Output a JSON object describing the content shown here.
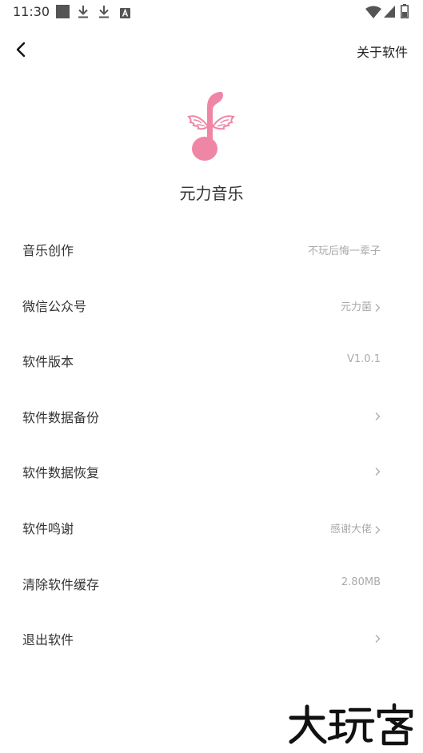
{
  "status_bar": {
    "time": "11:30",
    "icons": [
      "square-notification-icon",
      "download-icon",
      "download-icon",
      "a-notification-icon",
      "wifi-icon",
      "signal-icon",
      "battery-icon"
    ]
  },
  "app_bar": {
    "back_icon": "chevron-left-icon",
    "title": "关于软件"
  },
  "app": {
    "logo_icon": "winged-music-note-icon",
    "logo_color": "#ef86a6",
    "name": "元力音乐"
  },
  "settings": [
    {
      "label": "音乐创作",
      "value": "不玩后悔一辈子",
      "chevron": false
    },
    {
      "label": "微信公众号",
      "value": "元力菌",
      "chevron": true
    },
    {
      "label": "软件版本",
      "value": "V1.0.1",
      "chevron": false
    },
    {
      "label": "软件数据备份",
      "value": "",
      "chevron": true
    },
    {
      "label": "软件数据恢复",
      "value": "",
      "chevron": true
    },
    {
      "label": "软件鸣谢",
      "value": "感谢大佬",
      "chevron": true
    },
    {
      "label": "清除软件缓存",
      "value": "2.80MB",
      "chevron": false
    },
    {
      "label": "退出软件",
      "value": "",
      "chevron": true
    }
  ],
  "watermark": {
    "text": "大玩客"
  },
  "colors": {
    "accent": "#ef86a6",
    "value_text": "#aaaaaa",
    "label_text": "#333333"
  }
}
